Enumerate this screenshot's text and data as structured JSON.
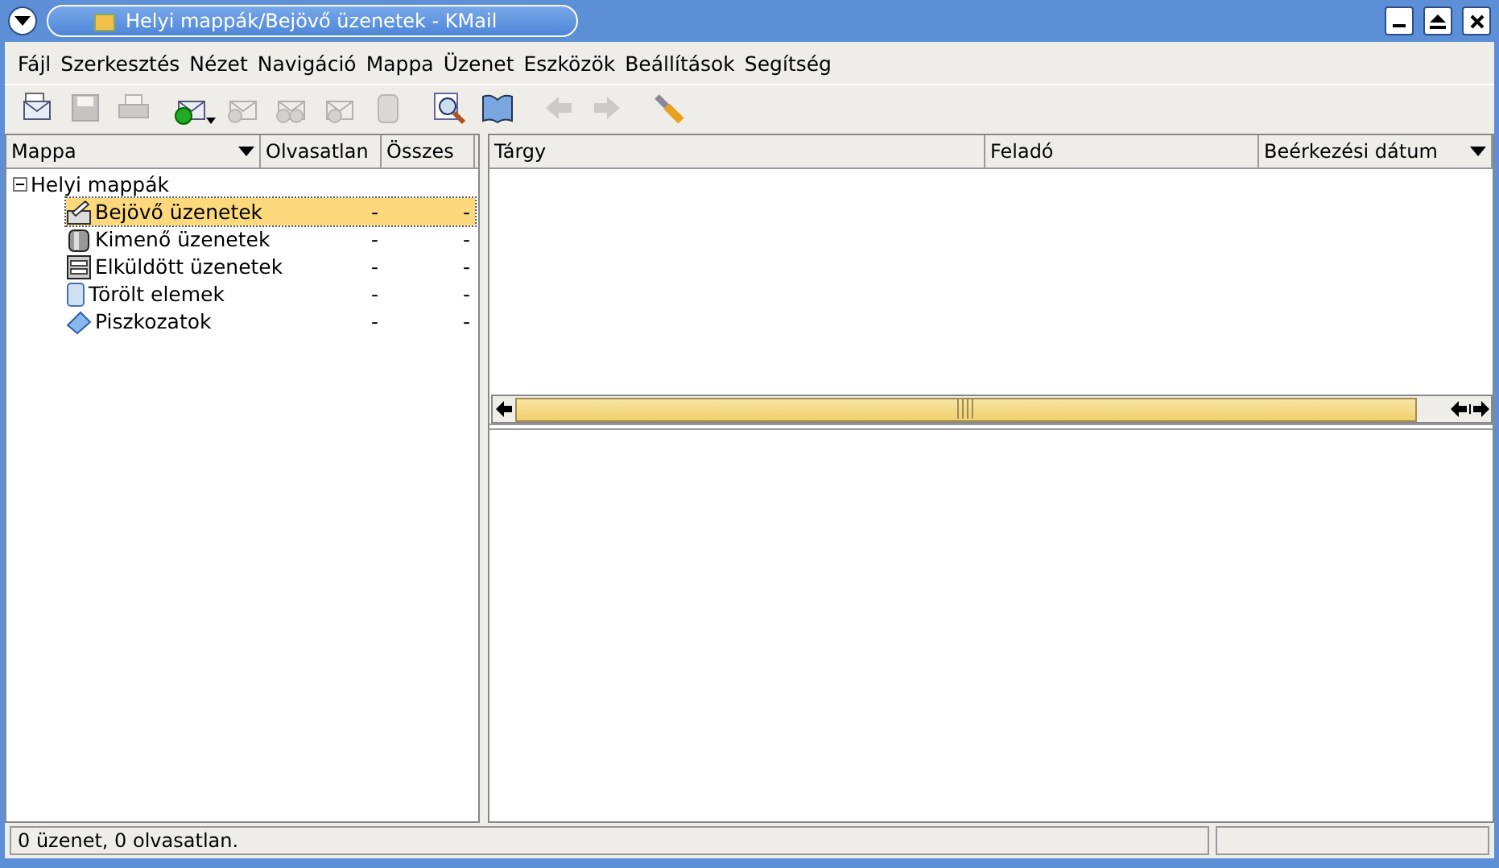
{
  "window": {
    "title": "Helyi mappák/Bejövő üzenetek - KMail"
  },
  "menu": [
    "Fájl",
    "Szerkesztés",
    "Nézet",
    "Navigáció",
    "Mappa",
    "Üzenet",
    "Eszközök",
    "Beállítások",
    "Segítség"
  ],
  "toolbar": [
    {
      "kind": "new",
      "disabled": false
    },
    {
      "kind": "save",
      "disabled": true
    },
    {
      "kind": "print",
      "disabled": true
    },
    {
      "kind": "check",
      "disabled": false
    },
    {
      "kind": "reply",
      "disabled": true
    },
    {
      "kind": "replyall",
      "disabled": true
    },
    {
      "kind": "forward",
      "disabled": true
    },
    {
      "kind": "trash",
      "disabled": true
    },
    {
      "kind": "find",
      "disabled": false
    },
    {
      "kind": "book",
      "disabled": false
    },
    {
      "kind": "back",
      "disabled": true
    },
    {
      "kind": "next",
      "disabled": true
    },
    {
      "kind": "tools",
      "disabled": false
    }
  ],
  "folder_columns": [
    {
      "label": "Mappa",
      "sort": true
    },
    {
      "label": "Olvasatlan",
      "sort": false
    },
    {
      "label": "Összes",
      "sort": false
    }
  ],
  "folders": [
    {
      "name": "Helyi mappák",
      "expanded": true,
      "children": [
        {
          "name": "Bejövő üzenetek",
          "kind": "inbox",
          "unread": "-",
          "total": "-",
          "selected": true
        },
        {
          "name": "Kimenő üzenetek",
          "kind": "outbox",
          "unread": "-",
          "total": "-",
          "selected": false
        },
        {
          "name": "Elküldött üzenetek",
          "kind": "sent",
          "unread": "-",
          "total": "-",
          "selected": false
        },
        {
          "name": "Törölt elemek",
          "kind": "trash",
          "unread": "-",
          "total": "-",
          "selected": false
        },
        {
          "name": "Piszkozatok",
          "kind": "drafts",
          "unread": "-",
          "total": "-",
          "selected": false
        }
      ]
    }
  ],
  "message_columns": [
    {
      "label": "Tárgy",
      "sort": false
    },
    {
      "label": "Feladó",
      "sort": false
    },
    {
      "label": "Beérkezési dátum",
      "sort": true
    }
  ],
  "status_bar": {
    "message": "0 üzenet, 0 olvasatlan."
  }
}
